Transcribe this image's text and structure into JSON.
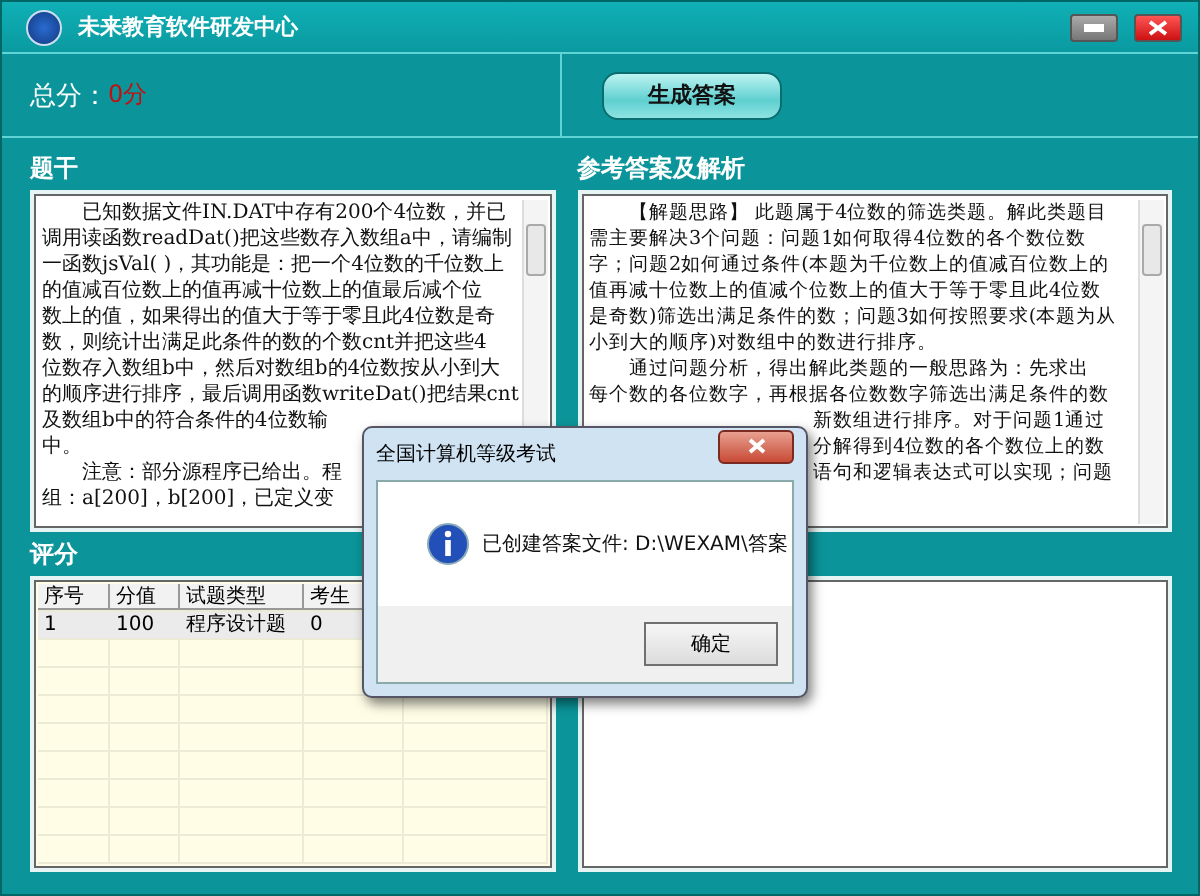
{
  "window": {
    "title": "未来教育软件研发中心"
  },
  "score": {
    "label": "总分：",
    "value": "0分"
  },
  "generate_button": "生成答案",
  "question": {
    "title": "题干",
    "lines": [
      "　　已知数据文件IN.DAT中存有200个4位数，并已",
      "调用读函数readDat()把这些数存入数组a中，请编制",
      "一函数jsVal( )，其功能是：把一个4位数的千位数上",
      "的值减百位数上的值再减十位数上的值最后减个位",
      "数上的值，如果得出的值大于等于零且此4位数是奇",
      "数，则统计出满足此条件的数的个数cnt并把这些4",
      "位数存入数组b中，然后对数组b的4位数按从小到大",
      "的顺序进行排序，最后调用函数writeDat()把结果cnt",
      "及数组b中的符合条件的4位数输",
      "中。",
      "　　注意：部分源程序已给出。程",
      "组：a[200]，b[200]，已定义变"
    ]
  },
  "answer": {
    "title": "参考答案及解析",
    "lines": [
      "　　【解题思路】 此题属于4位数的筛选类题。解此类题目",
      "需主要解决3个问题：问题1如何取得4位数的各个数位数",
      "字；问题2如何通过条件(本题为千位数上的值减百位数上的",
      "值再减十位数上的值减个位数上的值大于等于零且此4位数",
      "是奇数)筛选出满足条件的数；问题3如何按照要求(本题为从",
      "小到大的顺序)对数组中的数进行排序。",
      "　　通过问题分析，得出解此类题的一般思路为：先求出",
      "每个数的各位数字，再根据各位数数字筛选出满足条件的数",
      {
        "kind": "covered",
        "text": "新数组进行排序。对于问题1通过"
      },
      {
        "kind": "covered",
        "text": "分解得到4位数的各个数位上的数"
      },
      {
        "kind": "covered",
        "text": "语句和逻辑表达式可以实现；问题"
      }
    ]
  },
  "grading": {
    "title": "评分",
    "columns": [
      "序号",
      "分值",
      "试题类型",
      "考生"
    ],
    "rows": [
      {
        "cells": [
          "1",
          "100",
          "程序设计题",
          "0"
        ],
        "selected": true
      }
    ]
  },
  "dialog": {
    "title": "全国计算机等级考试",
    "message": "已创建答案文件: D:\\WEXAM\\答案",
    "button": "确定"
  }
}
